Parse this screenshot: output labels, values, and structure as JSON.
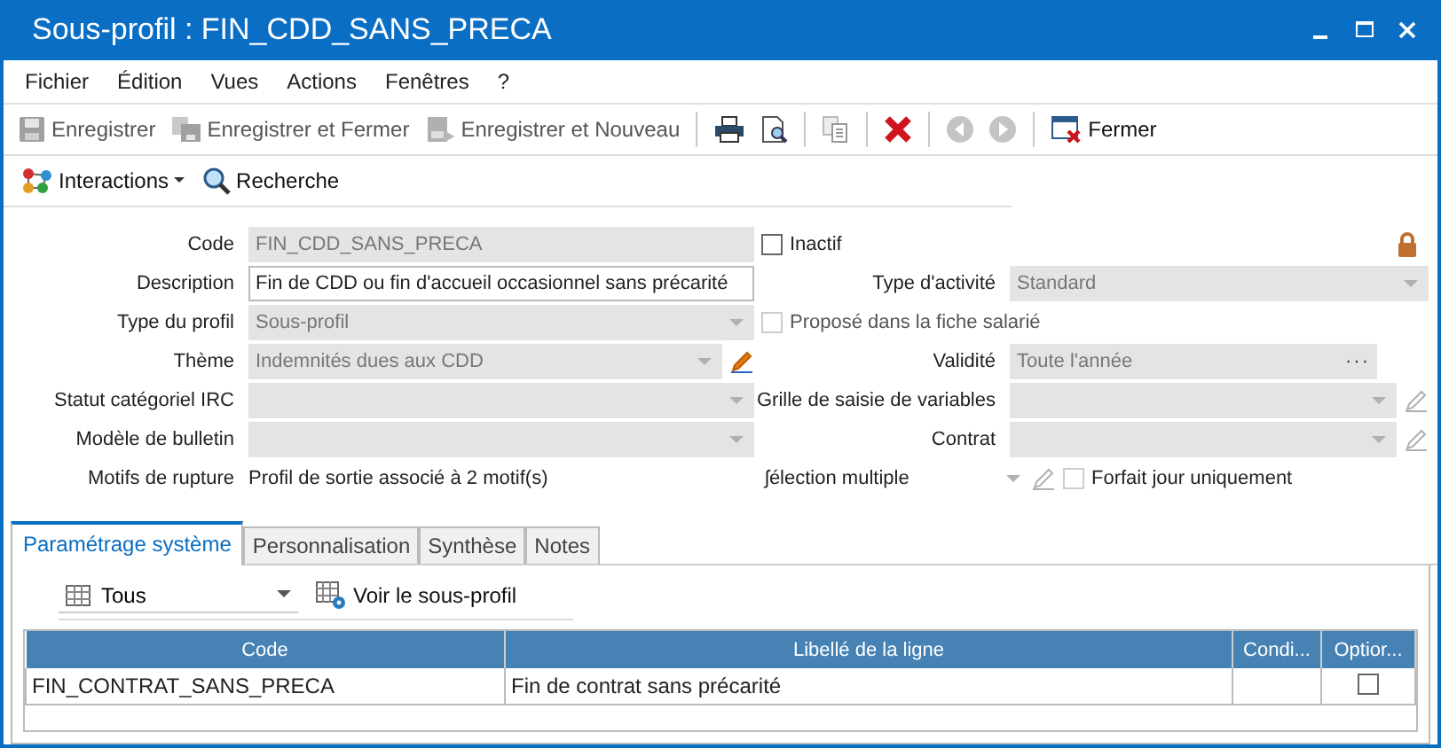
{
  "window": {
    "title": "Sous-profil : FIN_CDD_SANS_PRECA"
  },
  "menu": [
    "Fichier",
    "Édition",
    "Vues",
    "Actions",
    "Fenêtres",
    "?"
  ],
  "toolbar": [
    {
      "kind": "button",
      "label": "Enregistrer",
      "disabled": true
    },
    {
      "kind": "button",
      "label": "Enregistrer et Fermer",
      "disabled": true
    },
    {
      "kind": "button",
      "label": "Enregistrer et Nouveau",
      "disabled": true
    },
    {
      "kind": "separator"
    },
    {
      "kind": "icon",
      "disabled": false
    },
    {
      "kind": "icon",
      "disabled": false
    },
    {
      "kind": "separator"
    },
    {
      "kind": "icon",
      "disabled": true
    },
    {
      "kind": "separator"
    },
    {
      "kind": "icon",
      "disabled": false
    },
    {
      "kind": "separator"
    },
    {
      "kind": "icon",
      "disabled": true
    },
    {
      "kind": "icon",
      "disabled": true
    },
    {
      "kind": "separator"
    },
    {
      "kind": "button",
      "label": "Fermer",
      "disabled": false
    }
  ],
  "toolbar2": [
    {
      "kind": "menu",
      "label": "Interactions"
    },
    {
      "kind": "button",
      "label": "Recherche"
    }
  ],
  "form": {
    "left": [
      {
        "kind": "readonly",
        "label": "Code",
        "value": "FIN_CDD_SANS_PRECA"
      },
      {
        "kind": "input",
        "label": "Description",
        "value": "Fin de CDD ou fin d'accueil occasionnel sans précarité"
      },
      {
        "kind": "combo",
        "label": "Type du profil",
        "value": "Sous-profil"
      },
      {
        "kind": "combo",
        "label": "Thème",
        "value": "Indemnités dues aux CDD",
        "editable": true
      },
      {
        "kind": "combo",
        "label": "Statut catégoriel IRC"
      },
      {
        "kind": "combo",
        "label": "Modèle de bulletin"
      },
      {
        "kind": "static",
        "label": "Motifs de rupture",
        "value": "Profil de sortie associé à 2 motif(s)"
      }
    ],
    "right": [
      {
        "kind": "checkbox",
        "label": "Inactif",
        "checked": false,
        "disabled": false,
        "locked": true
      },
      {
        "kind": "combo",
        "label": "Type d'activité",
        "value": "Standard"
      },
      {
        "kind": "checkbox",
        "label": "Proposé dans la fiche salarié",
        "checked": false,
        "disabled": true
      },
      {
        "kind": "ellipsis",
        "label": "Validité",
        "value": "Toute l'année",
        "button": "···"
      },
      {
        "kind": "combo",
        "label": "Grille de saisie de variables",
        "editable": false
      },
      {
        "kind": "combo",
        "label": "Contrat",
        "editable": false
      },
      {
        "kind": "multi",
        "label": "ʃélection multiple",
        "editable": false,
        "option": {
          "label": "Forfait jour uniquement",
          "checked": false
        }
      }
    ]
  },
  "tabs": [
    {
      "label": "Paramétrage système",
      "selected": true
    },
    {
      "label": "Personnalisation",
      "selected": false
    },
    {
      "label": "Synthèse",
      "selected": false
    },
    {
      "label": "Notes",
      "selected": false
    }
  ],
  "subtoolbar": {
    "filter": "Tous",
    "button": "Voir le sous-profil"
  },
  "table": {
    "columns": [
      "Code",
      "Libellé de la ligne",
      "Condi...",
      "Optior..."
    ],
    "rows": [
      {
        "code": "FIN_CONTRAT_SANS_PRECA",
        "libelle": "Fin de contrat sans précarité",
        "optional": false
      }
    ]
  }
}
